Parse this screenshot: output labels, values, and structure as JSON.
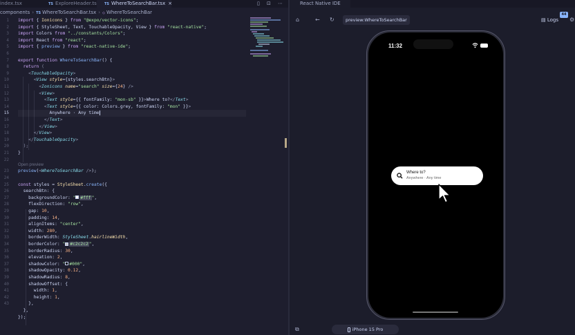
{
  "editor": {
    "tabs": [
      {
        "label": "index.tsx",
        "icon": "tsx-file-icon",
        "active": false
      },
      {
        "label": "ExploreHeader.tsx",
        "icon": "tsx-file-icon",
        "active": false
      },
      {
        "label": "WhereToSearchBar.tsx",
        "icon": "tsx-file-icon",
        "active": true
      }
    ],
    "tab_close": "×",
    "breadcrumb": [
      "components",
      "WhereToSearchBar.tsx",
      "WhereToSearchBar"
    ],
    "line_numbers": [
      "1",
      "2",
      "3",
      "4",
      "5",
      "6",
      "7",
      "8",
      "9",
      "10",
      "11",
      "12",
      "13",
      "14",
      "15",
      "16",
      "17",
      "18",
      "19",
      "20",
      "21",
      "22",
      "23",
      "24",
      "25",
      "26",
      "27",
      "28",
      "29",
      "30",
      "31",
      "32",
      "33",
      "34",
      "35",
      "36",
      "37",
      "38",
      "39",
      "40",
      "41",
      "42",
      "43"
    ],
    "active_line": "15",
    "code_hint": "Open preview"
  },
  "preview": {
    "tab_label": "React Native IDE",
    "url": "preview:WhereToSearchBar",
    "logs_label": "Logs",
    "badge_count": "44",
    "device_label": "iPhone 15 Pro",
    "phone": {
      "time": "11:32",
      "search_title": "Where to?",
      "search_subtitle": "Anywhere · Any time"
    }
  }
}
